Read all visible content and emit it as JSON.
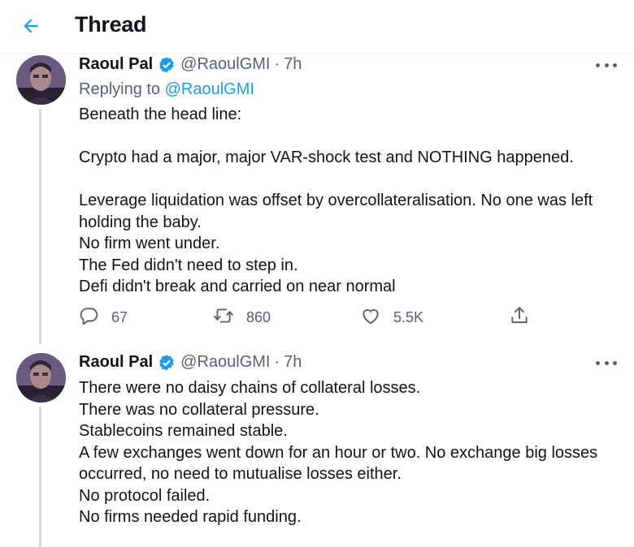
{
  "header": {
    "title": "Thread"
  },
  "tweets": [
    {
      "name": "Raoul Pal",
      "handle": "@RaoulGMI",
      "separator": "·",
      "time": "7h",
      "replying_prefix": "Replying to",
      "replying_handle": "@RaoulGMI",
      "lines": [
        "Beneath the head line:",
        "",
        "Crypto had a major, major VAR-shock test and NOTHING happened.",
        "",
        "Leverage liquidation was offset by overcollateralisation. No one was left",
        "holding the baby.",
        "No firm went under.",
        "The Fed didn't need to step in.",
        "Defi didn't break and carried on near normal"
      ],
      "replies": "67",
      "retweets": "860",
      "likes": "5.5K"
    },
    {
      "name": "Raoul Pal",
      "handle": "@RaoulGMI",
      "separator": "·",
      "time": "7h",
      "lines": [
        "There were no daisy chains of collateral losses.",
        "There was no collateral pressure.",
        "Stablecoins remained stable.",
        "A few exchanges went down for an hour or two. No exchange big losses",
        "occurred, no need to mutualise losses either.",
        "No protocol failed.",
        "No firms needed rapid funding."
      ]
    }
  ],
  "icons": {
    "back": "arrow-left-icon",
    "verified": "verified-badge-icon",
    "more": "more-dots-icon",
    "reply": "reply-bubble-icon",
    "retweet": "retweet-icon",
    "like": "heart-icon",
    "share": "share-icon"
  },
  "colors": {
    "accent": "#1d9bf0",
    "text": "#0f1419",
    "muted": "#536471",
    "thread_line": "#cfd9de"
  }
}
